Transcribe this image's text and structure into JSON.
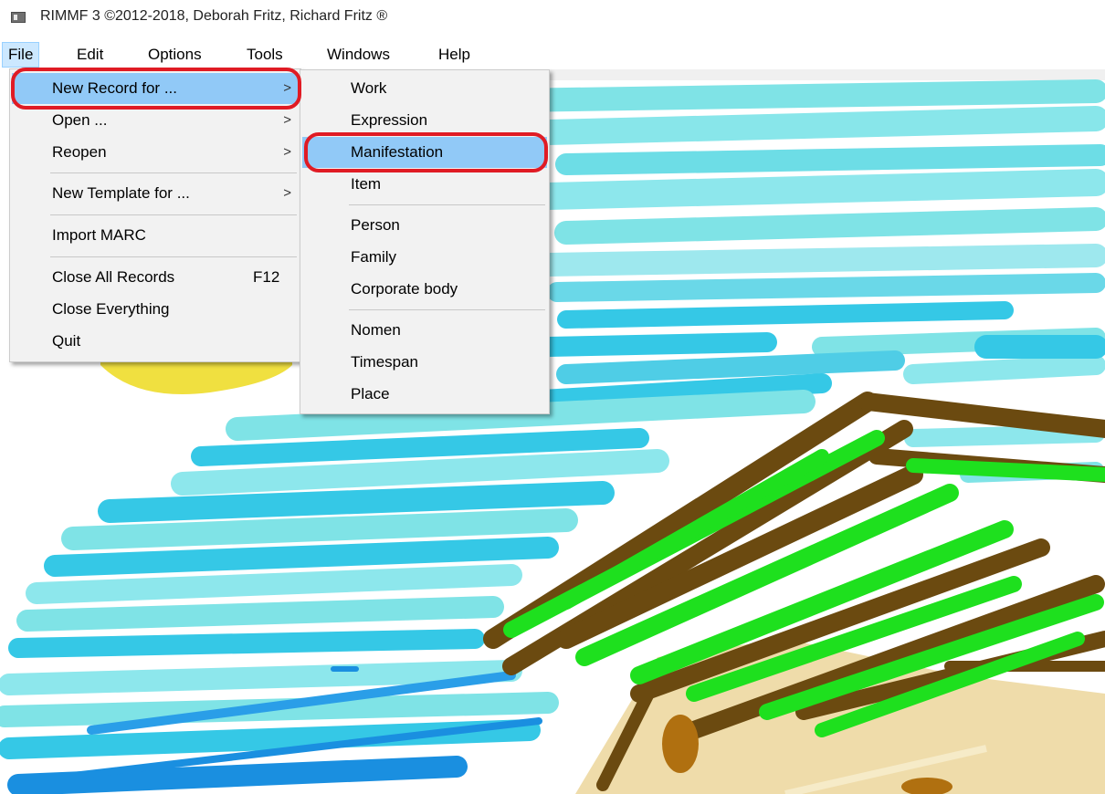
{
  "window": {
    "title": "RIMMF 3   ©2012-2018, Deborah Fritz, Richard Fritz ®"
  },
  "menubar": {
    "items": [
      "File",
      "Edit",
      "Options",
      "Tools",
      "Windows",
      "Help"
    ]
  },
  "file_menu": {
    "new_record": "New Record for ...",
    "open": "Open ...",
    "reopen": "Reopen",
    "new_template": "New Template for ...",
    "import_marc": "Import MARC",
    "close_all_records": "Close All Records",
    "close_all_records_shortcut": "F12",
    "close_everything": "Close Everything",
    "quit": "Quit",
    "submenu_arrow": ">"
  },
  "submenu": {
    "work": "Work",
    "expression": "Expression",
    "manifestation": "Manifestation",
    "item": "Item",
    "person": "Person",
    "family": "Family",
    "corporate_body": "Corporate body",
    "nomen": "Nomen",
    "timespan": "Timespan",
    "place": "Place"
  },
  "colors": {
    "menu_bg": "#f2f2f2",
    "highlight": "#91c9f7",
    "annotation": "#e01b24",
    "sky_light": "#7fe3e6",
    "sky_mid": "#35c8e6",
    "water_blue": "#1a8fe0",
    "grass_green": "#1ee01e",
    "wood_brown": "#6b4a10",
    "sand": "#efdcaa",
    "sun_yellow": "#f0e040"
  }
}
